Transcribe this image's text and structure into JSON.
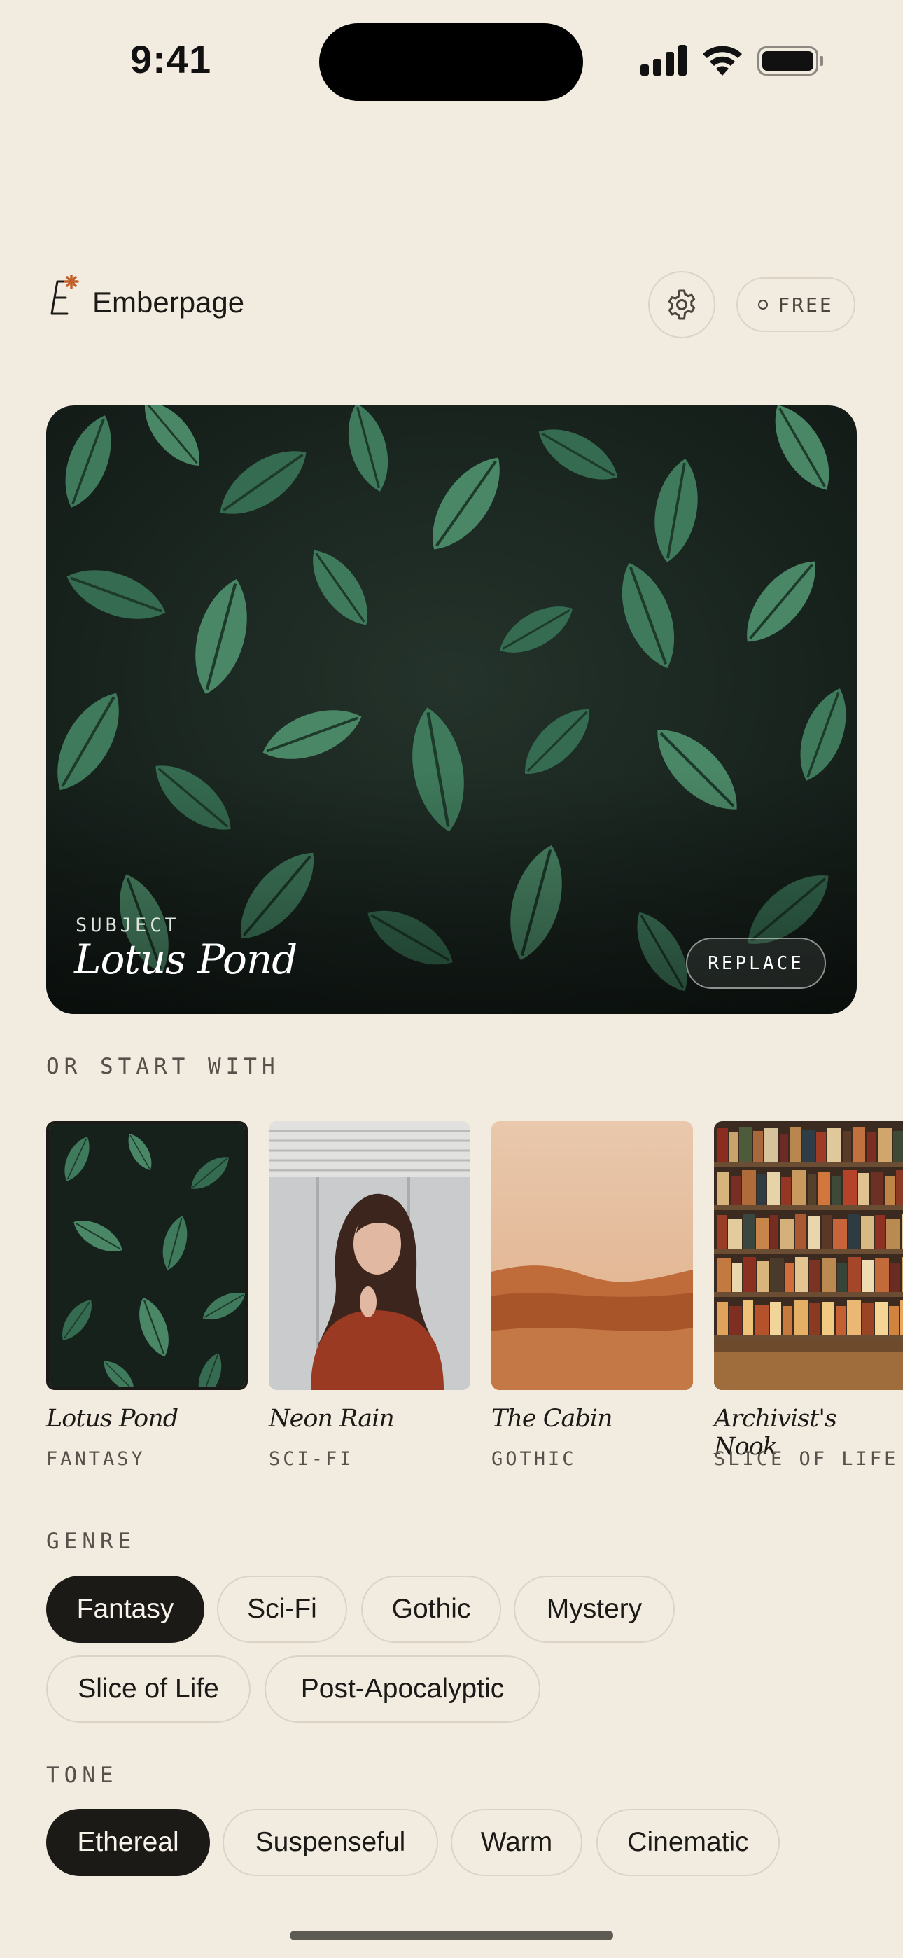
{
  "status_bar": {
    "time": "9:41"
  },
  "header": {
    "brand": "Emberpage",
    "plan_label": "FREE"
  },
  "hero": {
    "kicker": "SUBJECT",
    "title": "Lotus Pond",
    "replace_label": "REPLACE"
  },
  "starters": {
    "label": "OR START WITH",
    "items": [
      {
        "title": "Lotus Pond",
        "genre": "FANTASY",
        "selected": true
      },
      {
        "title": "Neon Rain",
        "genre": "SCI-FI",
        "selected": false
      },
      {
        "title": "The Cabin",
        "genre": "GOTHIC",
        "selected": false
      },
      {
        "title": "Archivist's Nook",
        "genre": "SLICE OF LIFE",
        "selected": false
      }
    ]
  },
  "genre": {
    "label": "GENRE",
    "options": [
      "Fantasy",
      "Sci-Fi",
      "Gothic",
      "Mystery",
      "Slice of Life",
      "Post-Apocalyptic"
    ],
    "selected": "Fantasy"
  },
  "tone": {
    "label": "TONE",
    "options": [
      "Ethereal",
      "Suspenseful",
      "Warm",
      "Cinematic"
    ],
    "selected": "Ethereal"
  },
  "colors": {
    "background": "#f2ebdf",
    "ink": "#1c1a17",
    "accent": "#c2602a",
    "leaf": "#3f7a5c"
  }
}
